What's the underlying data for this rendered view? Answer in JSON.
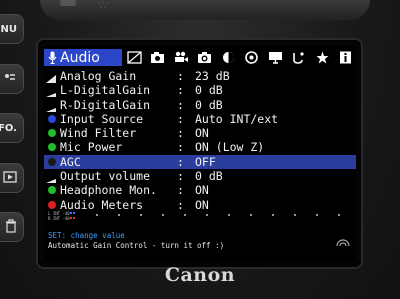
{
  "camera": {
    "buttons": [
      "MENU",
      "",
      "INFO.",
      "",
      ""
    ],
    "brand": "Canon"
  },
  "tabs": {
    "active_label": "Audio",
    "active_icon": "microphone-icon",
    "icons": [
      "image-quality-icon",
      "camera-icon",
      "movie-camera-icon",
      "camera-photo-icon",
      "exposure-icon",
      "aperture-icon",
      "display-icon",
      "brush-icon",
      "star-settings-icon",
      "info-icon"
    ]
  },
  "menu": {
    "rows": [
      {
        "label": "Analog Gain",
        "value": "23 dB",
        "marker": "gain-wedge-icon"
      },
      {
        "label": "L-DigitalGain",
        "value": "0 dB",
        "marker": "gain-wedge-icon"
      },
      {
        "label": "R-DigitalGain",
        "value": "0 dB",
        "marker": "gain-wedge-icon"
      },
      {
        "label": "Input Source",
        "value": "Auto INT/ext",
        "marker": "blue-dot"
      },
      {
        "label": "Wind Filter",
        "value": "ON",
        "marker": "green-dot"
      },
      {
        "label": "Mic Power",
        "value": "ON (Low Z)",
        "marker": "green-dot"
      },
      {
        "label": "AGC",
        "value": "OFF",
        "marker": "dark-dot",
        "selected": true
      },
      {
        "label": "Output volume",
        "value": "0 dB",
        "marker": "gain-wedge-icon"
      },
      {
        "label": "Headphone Mon.",
        "value": "ON",
        "marker": "green-dot"
      },
      {
        "label": "Audio Meters",
        "value": "ON",
        "marker": "red-dot"
      }
    ]
  },
  "meters": {
    "left_label": "L INT -40",
    "right_label": "R INT -40"
  },
  "help": {
    "line1": "SET: change value",
    "line2": "Automatic Gain Control - turn it off :)"
  },
  "colors": {
    "tab_active": "#2b46c8",
    "selection": "#2b3e9e",
    "help_text": "#3aa0ff"
  }
}
